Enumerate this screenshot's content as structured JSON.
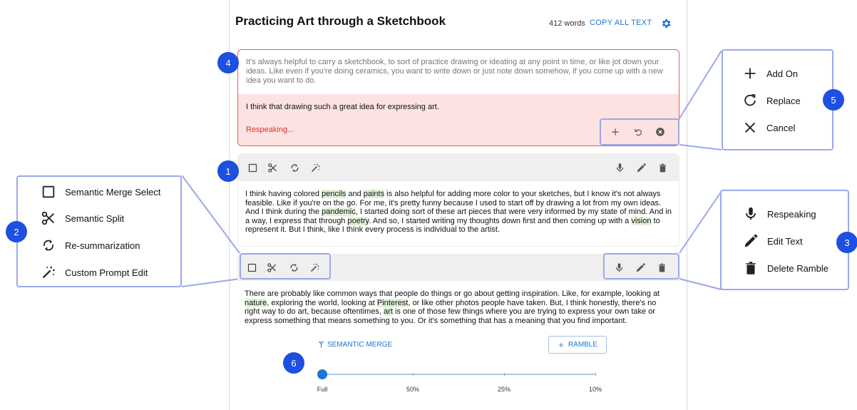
{
  "header": {
    "title": "Practicing Art through a Sketchbook",
    "word_count": "412 words",
    "copy_label": "COPY ALL TEXT",
    "settings_icon": "gear-icon"
  },
  "respeaking_card": {
    "original_text": "It's always helpful to carry a sketchbook, to sort of practice drawing or ideating at any point in time, or like jot down your ideas. Like even if you're doing ceramics, you want to write down or just note down somehow, if you come up with a new idea you want to do.",
    "new_text": "I think that drawing such a great idea for expressing art.",
    "status": "Respeaking...",
    "actions": [
      "plus-icon",
      "replace-icon",
      "cancel-icon"
    ]
  },
  "rambles": [
    {
      "segments": [
        {
          "t": "I think having colored "
        },
        {
          "t": "pencils",
          "h": true
        },
        {
          "t": " and "
        },
        {
          "t": "paints",
          "h": true
        },
        {
          "t": " is also helpful for adding more color to your sketches, but I know it's not always feasible. Like if you're on the go. For me, it's pretty funny because I used to start off by drawing a lot from my own ideas. And I think during the "
        },
        {
          "t": "pandemic",
          "h": true
        },
        {
          "t": ", I started doing sort of these art pieces that were very informed by my state of mind. And in a way, I express that through "
        },
        {
          "t": "poetry",
          "h": true
        },
        {
          "t": ". And so, I started writing my thoughts down first and then coming up with a "
        },
        {
          "t": "vision",
          "h": true
        },
        {
          "t": " to represent it. But I think, like I think every process is individual to the artist."
        }
      ]
    },
    {
      "segments": [
        {
          "t": "There are probably like common ways that people do things or go about getting inspiration. Like, for example, looking at "
        },
        {
          "t": "nature",
          "h": true
        },
        {
          "t": ", exploring the world, looking at "
        },
        {
          "t": "Pinterest",
          "h": true
        },
        {
          "t": ", or like other photos people have taken. But, I think honestly, there's no right way to do art, because oftentimes, "
        },
        {
          "t": "art",
          "h": true
        },
        {
          "t": " is one of those few things where you are trying to express your own take or express something that means something to you. Or it's something that has a meaning that you find important."
        }
      ]
    }
  ],
  "toolbar_icons": {
    "left": [
      "checkbox-icon",
      "scissors-icon",
      "cycle-icon",
      "magic-wand-icon"
    ],
    "right": [
      "microphone-icon",
      "pencil-icon",
      "trash-icon"
    ]
  },
  "bottom": {
    "merge_label": "SEMANTIC MERGE",
    "ramble_label": "RAMBLE",
    "slider_labels": [
      "Full",
      "50%",
      "25%",
      "10%"
    ],
    "slider_value": "Full"
  },
  "callouts": {
    "badges": [
      "1",
      "2",
      "3",
      "4",
      "5",
      "6"
    ],
    "left_panel": [
      "Semantic Merge Select",
      "Semantic Split",
      "Re-summarization",
      "Custom Prompt Edit"
    ],
    "right_panel": [
      "Respeaking",
      "Edit Text",
      "Delete Ramble"
    ],
    "top_panel": [
      "Add On",
      "Replace",
      "Cancel"
    ]
  },
  "colors": {
    "accent": "#1976d2",
    "badge": "#1d4fe0",
    "callout_border": "#9aa9e8",
    "highlight": "#e1f3d8",
    "respeak_bg": "#fde2e2",
    "respeak_border": "#f05a5a",
    "respeak_status": "#e0312b"
  }
}
